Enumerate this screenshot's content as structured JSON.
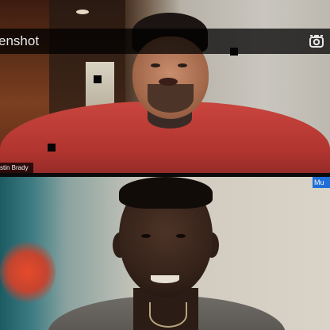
{
  "topbar": {
    "title": "enshot",
    "screenshot_icon": "camera-icon"
  },
  "participants": [
    {
      "name": "stin Brady"
    },
    {
      "badge": "Mu"
    }
  ],
  "colors": {
    "topbar_bg": "#000000",
    "badge_bg": "#1f6fd6",
    "name_tag_bg": "#000000"
  }
}
